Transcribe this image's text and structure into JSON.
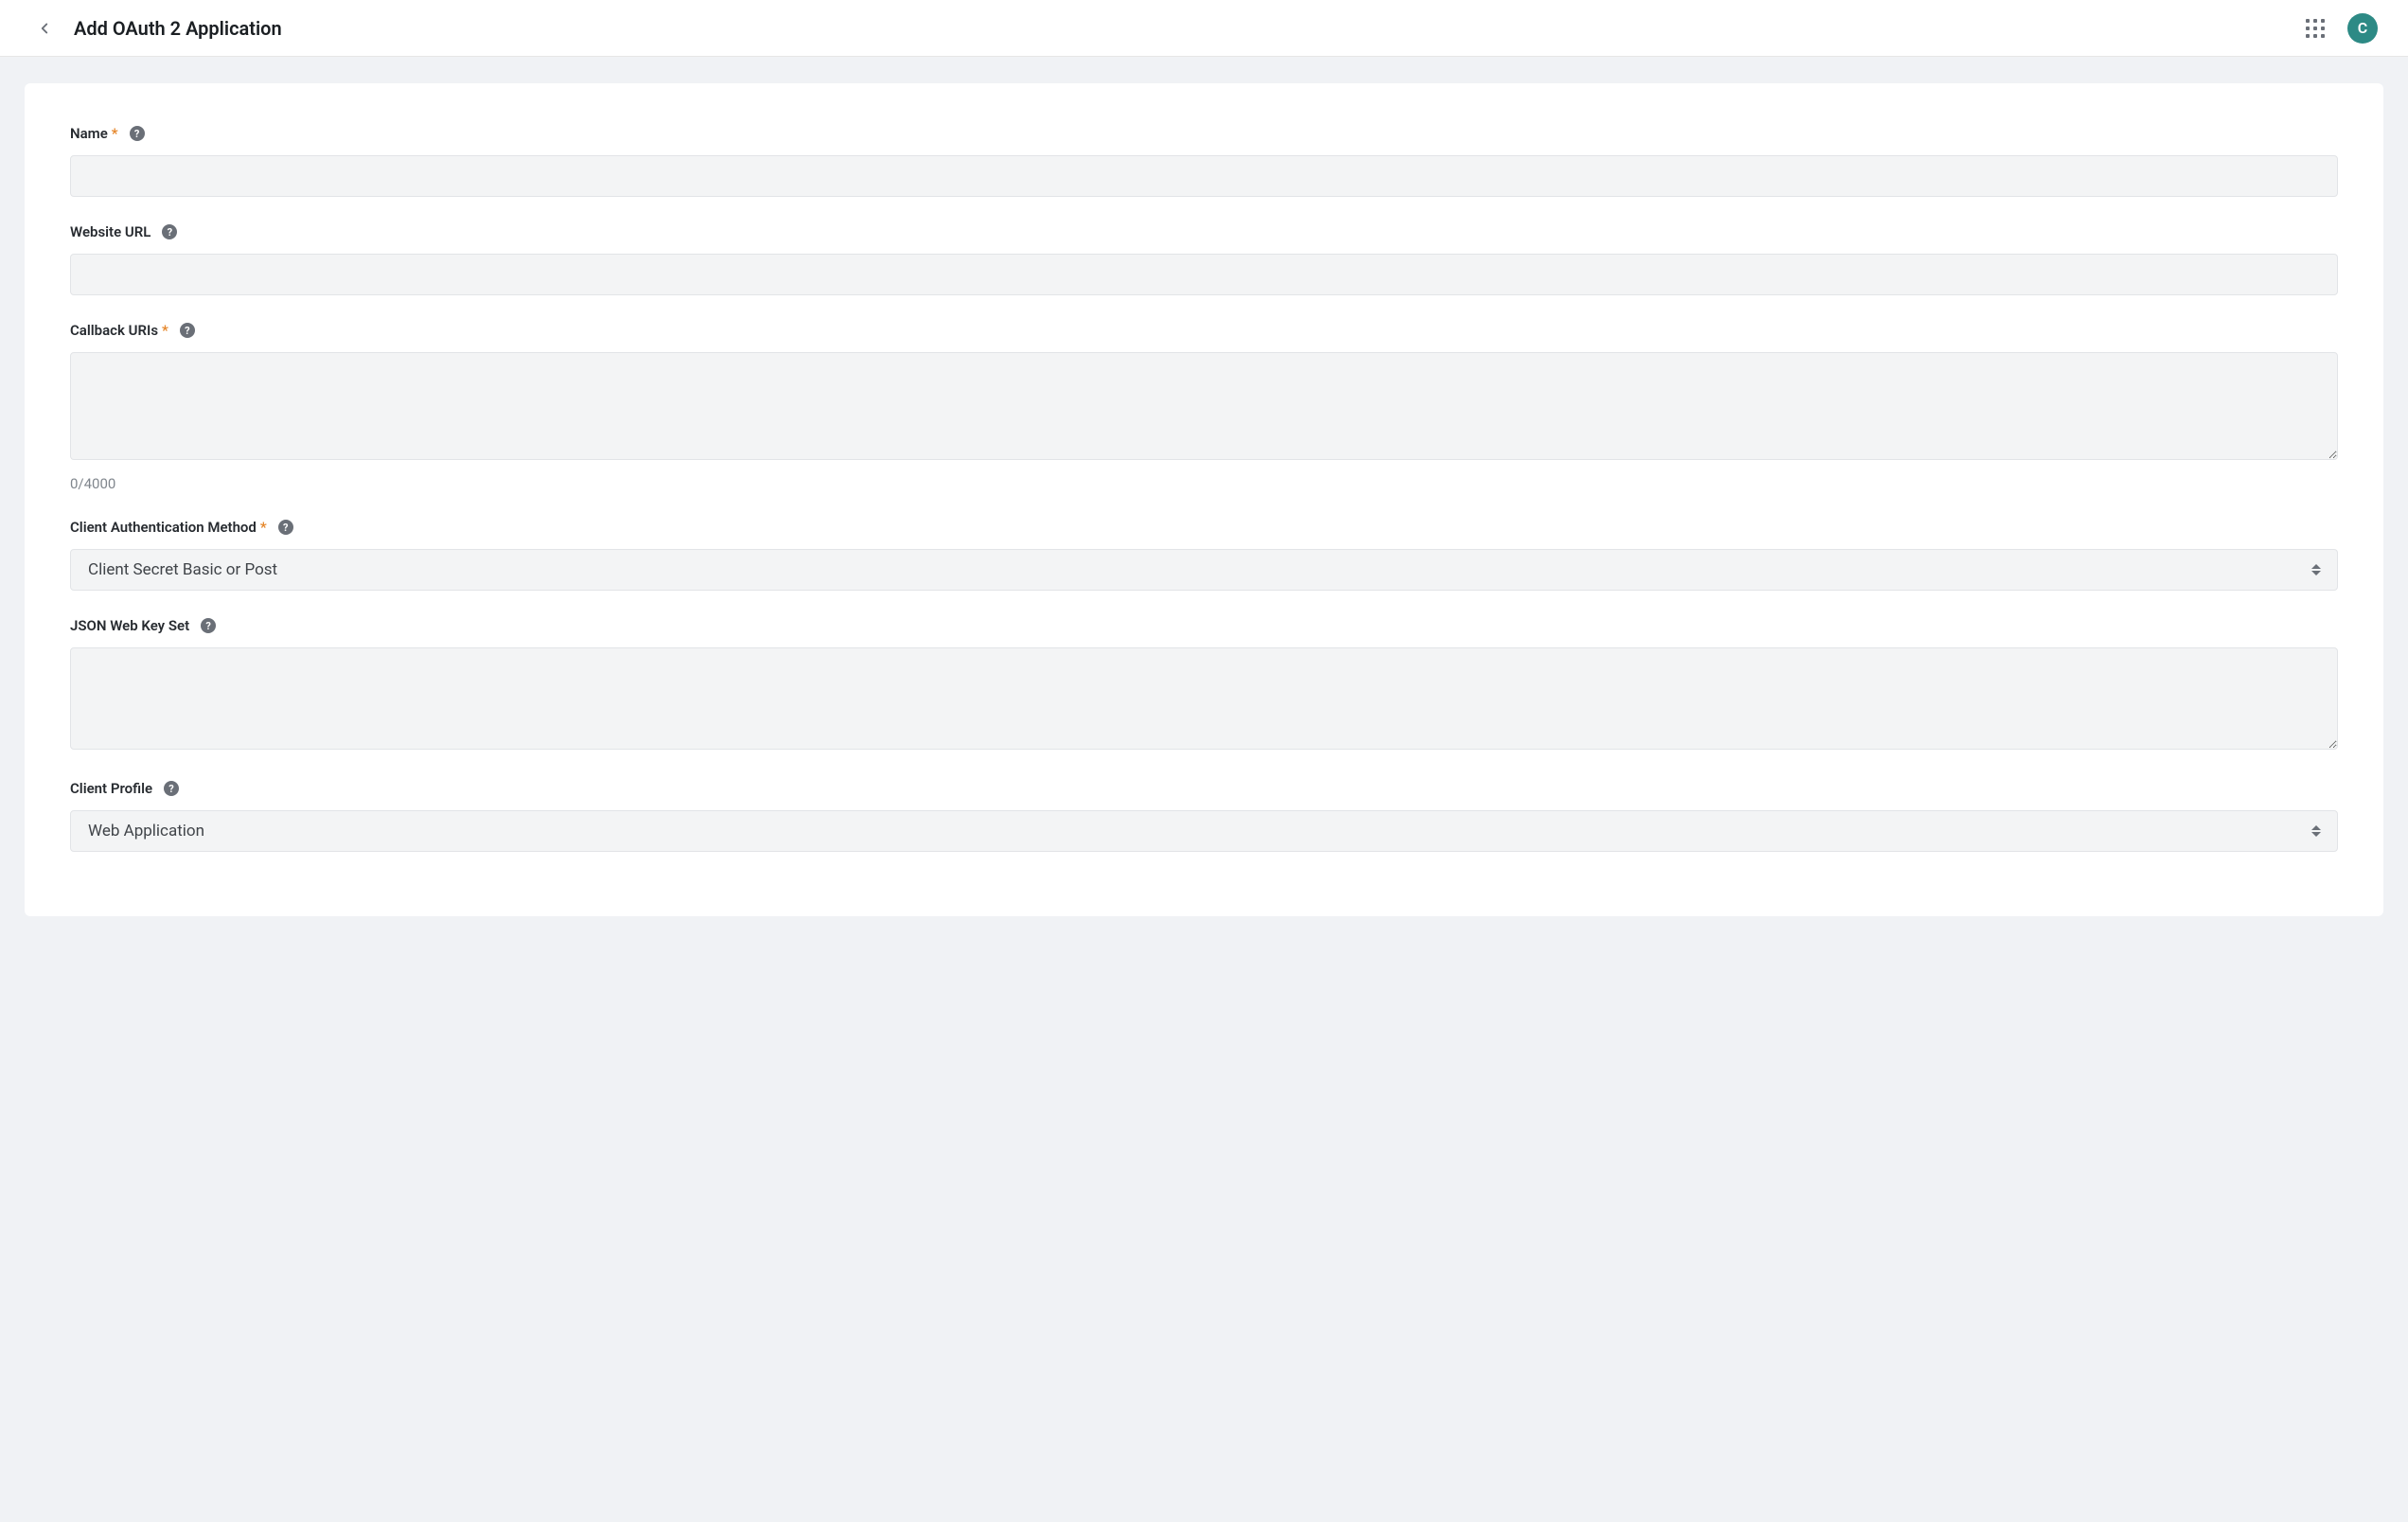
{
  "header": {
    "title": "Add OAuth 2 Application",
    "avatar_initial": "C"
  },
  "form": {
    "name": {
      "label": "Name",
      "required": true,
      "value": ""
    },
    "website_url": {
      "label": "Website URL",
      "required": false,
      "value": ""
    },
    "callback_uris": {
      "label": "Callback URIs",
      "required": true,
      "value": "",
      "char_count": "0/4000"
    },
    "client_auth_method": {
      "label": "Client Authentication Method",
      "required": true,
      "selected": "Client Secret Basic or Post"
    },
    "jwks": {
      "label": "JSON Web Key Set",
      "required": false,
      "value": ""
    },
    "client_profile": {
      "label": "Client Profile",
      "required": false,
      "selected": "Web Application"
    }
  }
}
